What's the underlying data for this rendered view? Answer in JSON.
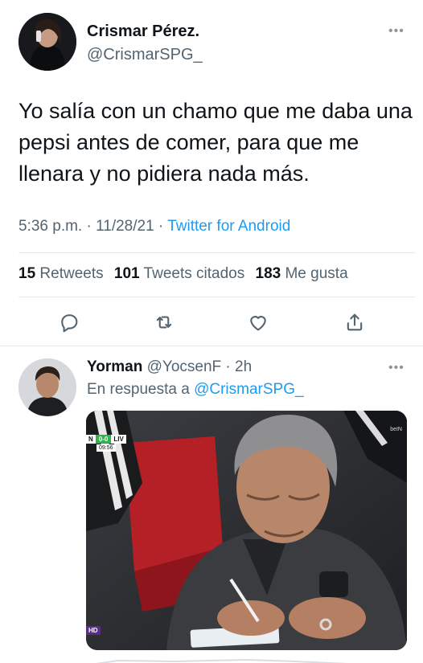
{
  "tweet": {
    "author_name": "Crismar Pérez.",
    "author_handle": "@CrismarSPG_",
    "more_icon": "more-horizontal-icon",
    "text": "Yo salía con un chamo que me daba una pepsi antes de comer, para que me llenara y no pidiera nada más.",
    "time": "5:36 p.m. · 11/28/21 · ",
    "source": "Twitter for Android",
    "stats": {
      "retweets_count": "15",
      "retweets_label": "Retweets",
      "quotes_count": "101",
      "quotes_label": "Tweets citados",
      "likes_count": "183",
      "likes_label": "Me gusta"
    },
    "actions": [
      "reply-icon",
      "retweet-icon",
      "like-icon",
      "share-icon"
    ]
  },
  "reply": {
    "author_name": "Yorman",
    "author_handle": "@YocsenF · 2h",
    "reply_prefix": "En respuesta a ",
    "reply_mention": "@CrismarSPG_",
    "media": {
      "scoreboard_home": "N",
      "scoreboard_score": "0-0",
      "scoreboard_away": "LIV",
      "scoreboard_clock": "09:56",
      "channel_logo": "beIN",
      "hd_badge": "HD"
    }
  },
  "colors": {
    "text": "#0f1419",
    "secondary": "#536471",
    "link": "#1d9bf0",
    "divider": "#e7eaec"
  }
}
